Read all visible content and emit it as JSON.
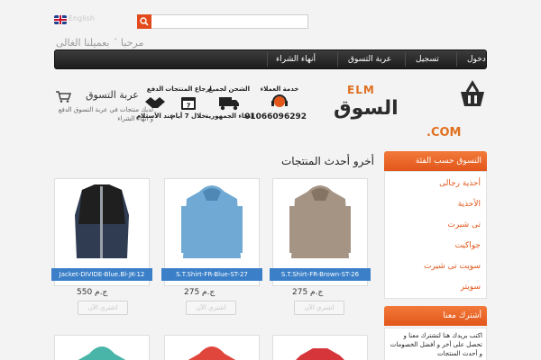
{
  "topbar": {
    "language": "English",
    "search_placeholder": ""
  },
  "welcome": "مرحبا ´ بعميلنا الغالى",
  "nav": {
    "items": [
      "دخول",
      "تسجيل",
      "عربة التسوق",
      "أنهاء الشراء"
    ]
  },
  "cart": {
    "title": "عربة التسوق",
    "subtitle": "لديك منتجات في عربة التسوق الدفع و أنهاء الشراء"
  },
  "features": [
    {
      "label": "خدمة العملاء",
      "sub": "01066096292",
      "icon": "headset-icon"
    },
    {
      "label": "الشحن لجميع",
      "sub": "انحاء الجمهورية",
      "icon": "truck-icon"
    },
    {
      "label": "ارجاع المنتجات",
      "sub": "خلال 7 أيام",
      "icon": "calendar-icon"
    },
    {
      "label": "الدفع",
      "sub": "عند الأستلام",
      "icon": "handshake-icon"
    }
  ],
  "logo": {
    "main": "السوق",
    "elm": "ELM",
    "com": ".COM"
  },
  "section_title": "أخرو أحدث المنتجات",
  "products": [
    {
      "name": "Jacket-DIVIDE-Blue.Bl-JK-12",
      "price": "ج.م 550",
      "button": "اشتري الآن",
      "color": "#2f3c52",
      "icon": "jacket-icon"
    },
    {
      "name": "S.T.Shirt-FR-Blue-ST-27",
      "price": "ج.م 275",
      "button": "اشتري الآن",
      "color": "#6fa9d4",
      "icon": "hoodie-icon"
    },
    {
      "name": "S.T.Shirt-FR-Brown-ST-26",
      "price": "ج.م 275",
      "button": "اشتري الآن",
      "color": "#a59484",
      "icon": "hoodie-icon"
    }
  ],
  "products_row2_colors": [
    "#49b5a8",
    "#e0463b",
    "#d6353a"
  ],
  "sidebar": {
    "heading": "التسوق حسب الفئة",
    "categories": [
      "أحذية رجالى",
      "الأحذية",
      "تى شيرت",
      "جواكيت",
      "سويت تى شيرت",
      "سويتر"
    ],
    "subscribe_heading": "أشترك معنا",
    "subscribe_text": "اكتب بريدك هنا لتشترك معنا و تحصل على أخر و أفضل الخصومات و أحدث المنتجات"
  },
  "colors": {
    "accent": "#e2561a",
    "nav": "#2a2a2a",
    "label_blue": "#3a7fc8"
  }
}
